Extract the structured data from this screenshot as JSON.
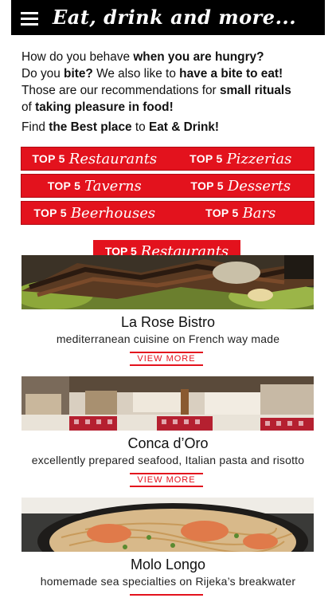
{
  "header": {
    "title": "Eat, drink and more...",
    "menu_icon": "hamburger-menu-icon"
  },
  "intro": {
    "l1a": "How do you behave ",
    "l1b": "when you are hungry?",
    "l2a": "Do you ",
    "l2b": "bite?",
    "l2c": " We also like to ",
    "l2d": "have a bite to eat!",
    "l3a": "Those are our recommendations for ",
    "l3b": "small rituals",
    "l4a": "of ",
    "l4b": "taking pleasure in food!",
    "l5a": "Find ",
    "l5b": "the Best place",
    "l5c": " to ",
    "l5d": "Eat & Drink!"
  },
  "categories": {
    "prefix": "TOP 5",
    "items": [
      "Restaurants",
      "Pizzerias",
      "Taverns",
      "Desserts",
      "Beerhouses",
      "Bars"
    ]
  },
  "section": {
    "prefix": "TOP 5",
    "name": "Restaurants"
  },
  "restaurants": [
    {
      "name": "La Rose Bistro",
      "desc": "mediterranean cuisine on French way made",
      "button": "VIEW MORE"
    },
    {
      "name": "Conca d’Oro",
      "desc": "excellently prepared seafood, Italian pasta and risotto",
      "button": "VIEW MORE"
    },
    {
      "name": "Molo Longo",
      "desc": "homemade sea specialties on Rijeka’s breakwater"
    }
  ],
  "colors": {
    "accent": "#e3121d",
    "header_bg": "#000000"
  }
}
